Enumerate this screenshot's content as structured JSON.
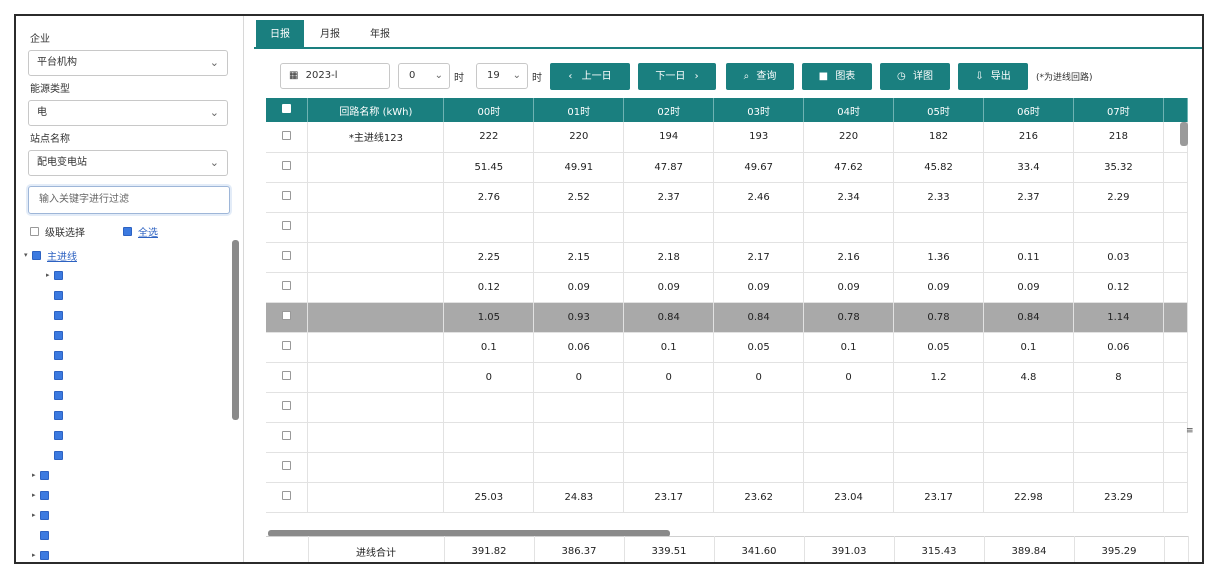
{
  "sidebar": {
    "company_label": "企业",
    "company_value": "平台机构",
    "energy_label": "能源类型",
    "energy_value": "电",
    "station_label": "站点名称",
    "station_value": "配电变电站",
    "search_placeholder": "输入关键字进行过滤",
    "cascade_label": "级联选择",
    "select_all_label": "全选",
    "tree_root_label": "主进线"
  },
  "tabs": [
    "日报",
    "月报",
    "年报"
  ],
  "toolbar": {
    "date_value": "2023-l",
    "hour_start": "0",
    "hour_start_unit": "时",
    "hour_end": "19",
    "hour_end_unit": "时",
    "prev_label": "上一日",
    "next_label": "下一日",
    "query_label": "查询",
    "chart_label": "图表",
    "detail_label": "详图",
    "export_label": "导出",
    "note": "(*为进线回路)"
  },
  "table": {
    "headers": [
      "回路名称 (kWh)",
      "00时",
      "01时",
      "02时",
      "03时",
      "04时",
      "05时",
      "06时",
      "07时"
    ],
    "rows": [
      {
        "name": "*主进线123",
        "values": [
          "222",
          "220",
          "194",
          "193",
          "220",
          "182",
          "216",
          "218"
        ]
      },
      {
        "name": "",
        "values": [
          "51.45",
          "49.91",
          "47.87",
          "49.67",
          "47.62",
          "45.82",
          "33.4",
          "35.32"
        ]
      },
      {
        "name": "",
        "values": [
          "2.76",
          "2.52",
          "2.37",
          "2.46",
          "2.34",
          "2.33",
          "2.37",
          "2.29"
        ]
      },
      {
        "name": "",
        "values": [
          "",
          "",
          "",
          "",
          "",
          "",
          "",
          ""
        ]
      },
      {
        "name": "",
        "values": [
          "2.25",
          "2.15",
          "2.18",
          "2.17",
          "2.16",
          "1.36",
          "0.11",
          "0.03"
        ]
      },
      {
        "name": "",
        "values": [
          "0.12",
          "0.09",
          "0.09",
          "0.09",
          "0.09",
          "0.09",
          "0.09",
          "0.12"
        ]
      },
      {
        "name": "",
        "values": [
          "1.05",
          "0.93",
          "0.84",
          "0.84",
          "0.78",
          "0.78",
          "0.84",
          "1.14"
        ],
        "highlight": true
      },
      {
        "name": "",
        "values": [
          "0.1",
          "0.06",
          "0.1",
          "0.05",
          "0.1",
          "0.05",
          "0.1",
          "0.06"
        ]
      },
      {
        "name": "",
        "values": [
          "0",
          "0",
          "0",
          "0",
          "0",
          "1.2",
          "4.8",
          "8"
        ]
      },
      {
        "name": "",
        "values": [
          "",
          "",
          "",
          "",
          "",
          "",
          "",
          ""
        ]
      },
      {
        "name": "",
        "values": [
          "",
          "",
          "",
          "",
          "",
          "",
          "",
          ""
        ]
      },
      {
        "name": "",
        "values": [
          "",
          "",
          "",
          "",
          "",
          "",
          "",
          ""
        ]
      },
      {
        "name": "",
        "values": [
          "25.03",
          "24.83",
          "23.17",
          "23.62",
          "23.04",
          "23.17",
          "22.98",
          "23.29"
        ]
      }
    ],
    "total_label": "进线合计",
    "totals": [
      "391.82",
      "386.37",
      "339.51",
      "341.60",
      "391.03",
      "315.43",
      "389.84",
      "395.29"
    ]
  },
  "edge_mark": "≡"
}
